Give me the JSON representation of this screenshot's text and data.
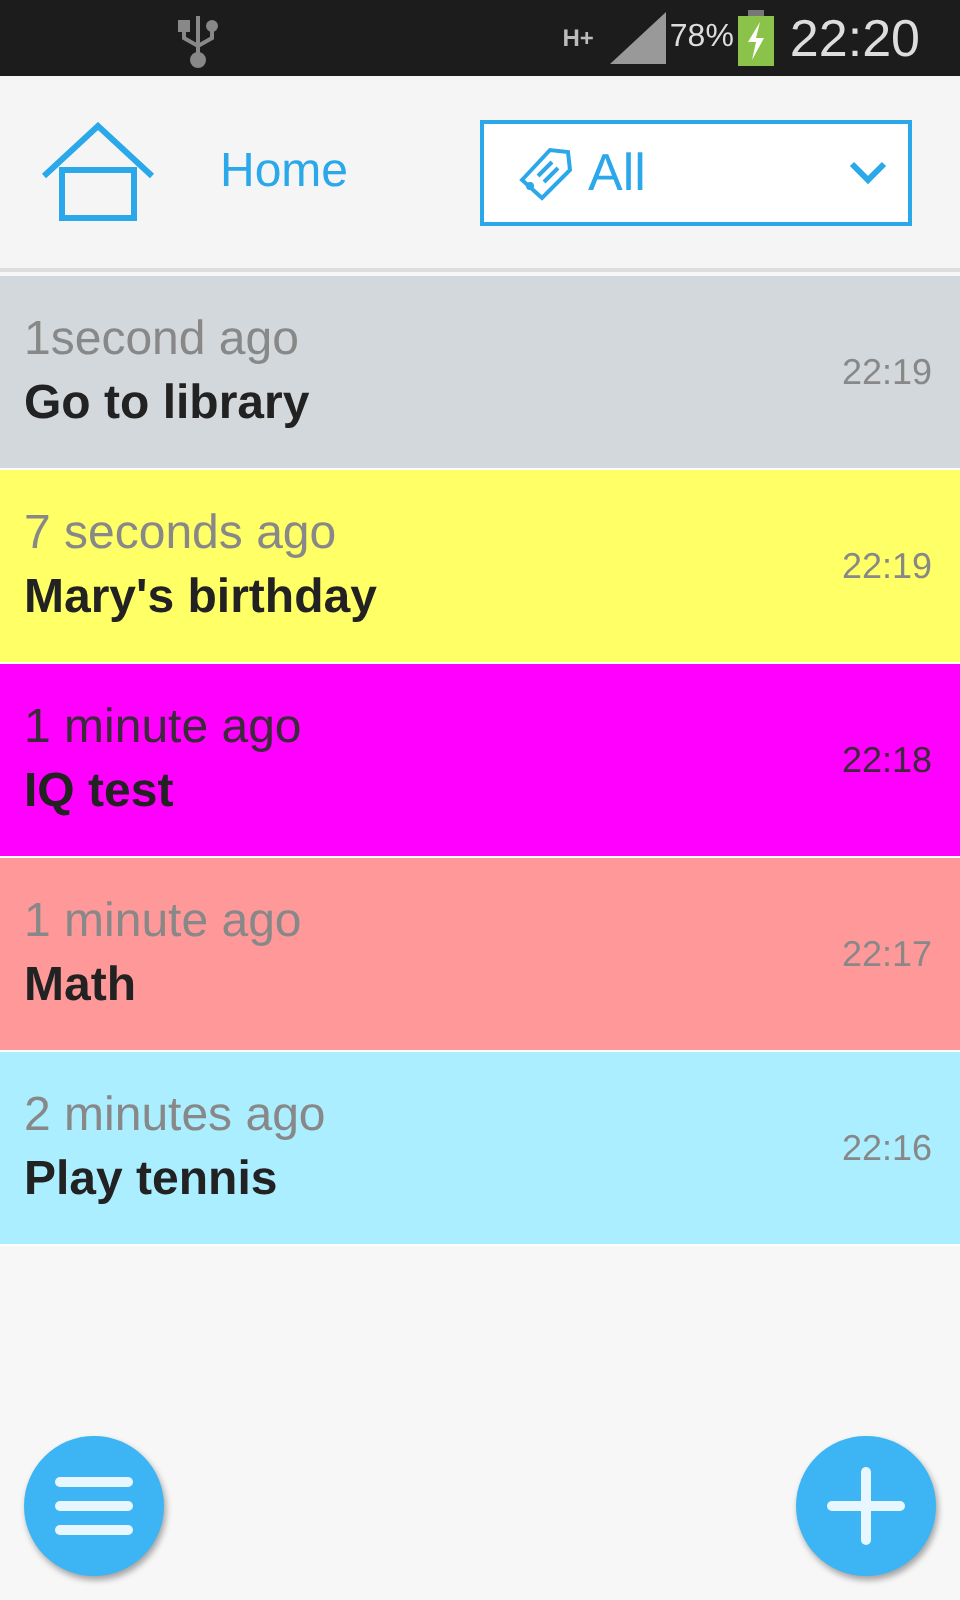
{
  "status_bar": {
    "battery_percent": "78%",
    "network": "H+",
    "time": "22:20"
  },
  "header": {
    "home_label": "Home",
    "filter": {
      "value": "All"
    }
  },
  "notes": [
    {
      "ago": "1second ago",
      "title": "Go to library",
      "time": "22:19",
      "color": "#d3d8dc"
    },
    {
      "ago": "7 seconds ago",
      "title": "Mary's birthday",
      "time": "22:19",
      "color": "#ffff66"
    },
    {
      "ago": "1 minute ago",
      "title": "IQ test",
      "time": "22:18",
      "color": "#ff00ff"
    },
    {
      "ago": "1 minute ago",
      "title": "Math",
      "time": "22:17",
      "color": "#ff9999"
    },
    {
      "ago": "2 minutes ago",
      "title": "Play tennis",
      "time": "22:16",
      "color": "#aaeeff"
    }
  ]
}
